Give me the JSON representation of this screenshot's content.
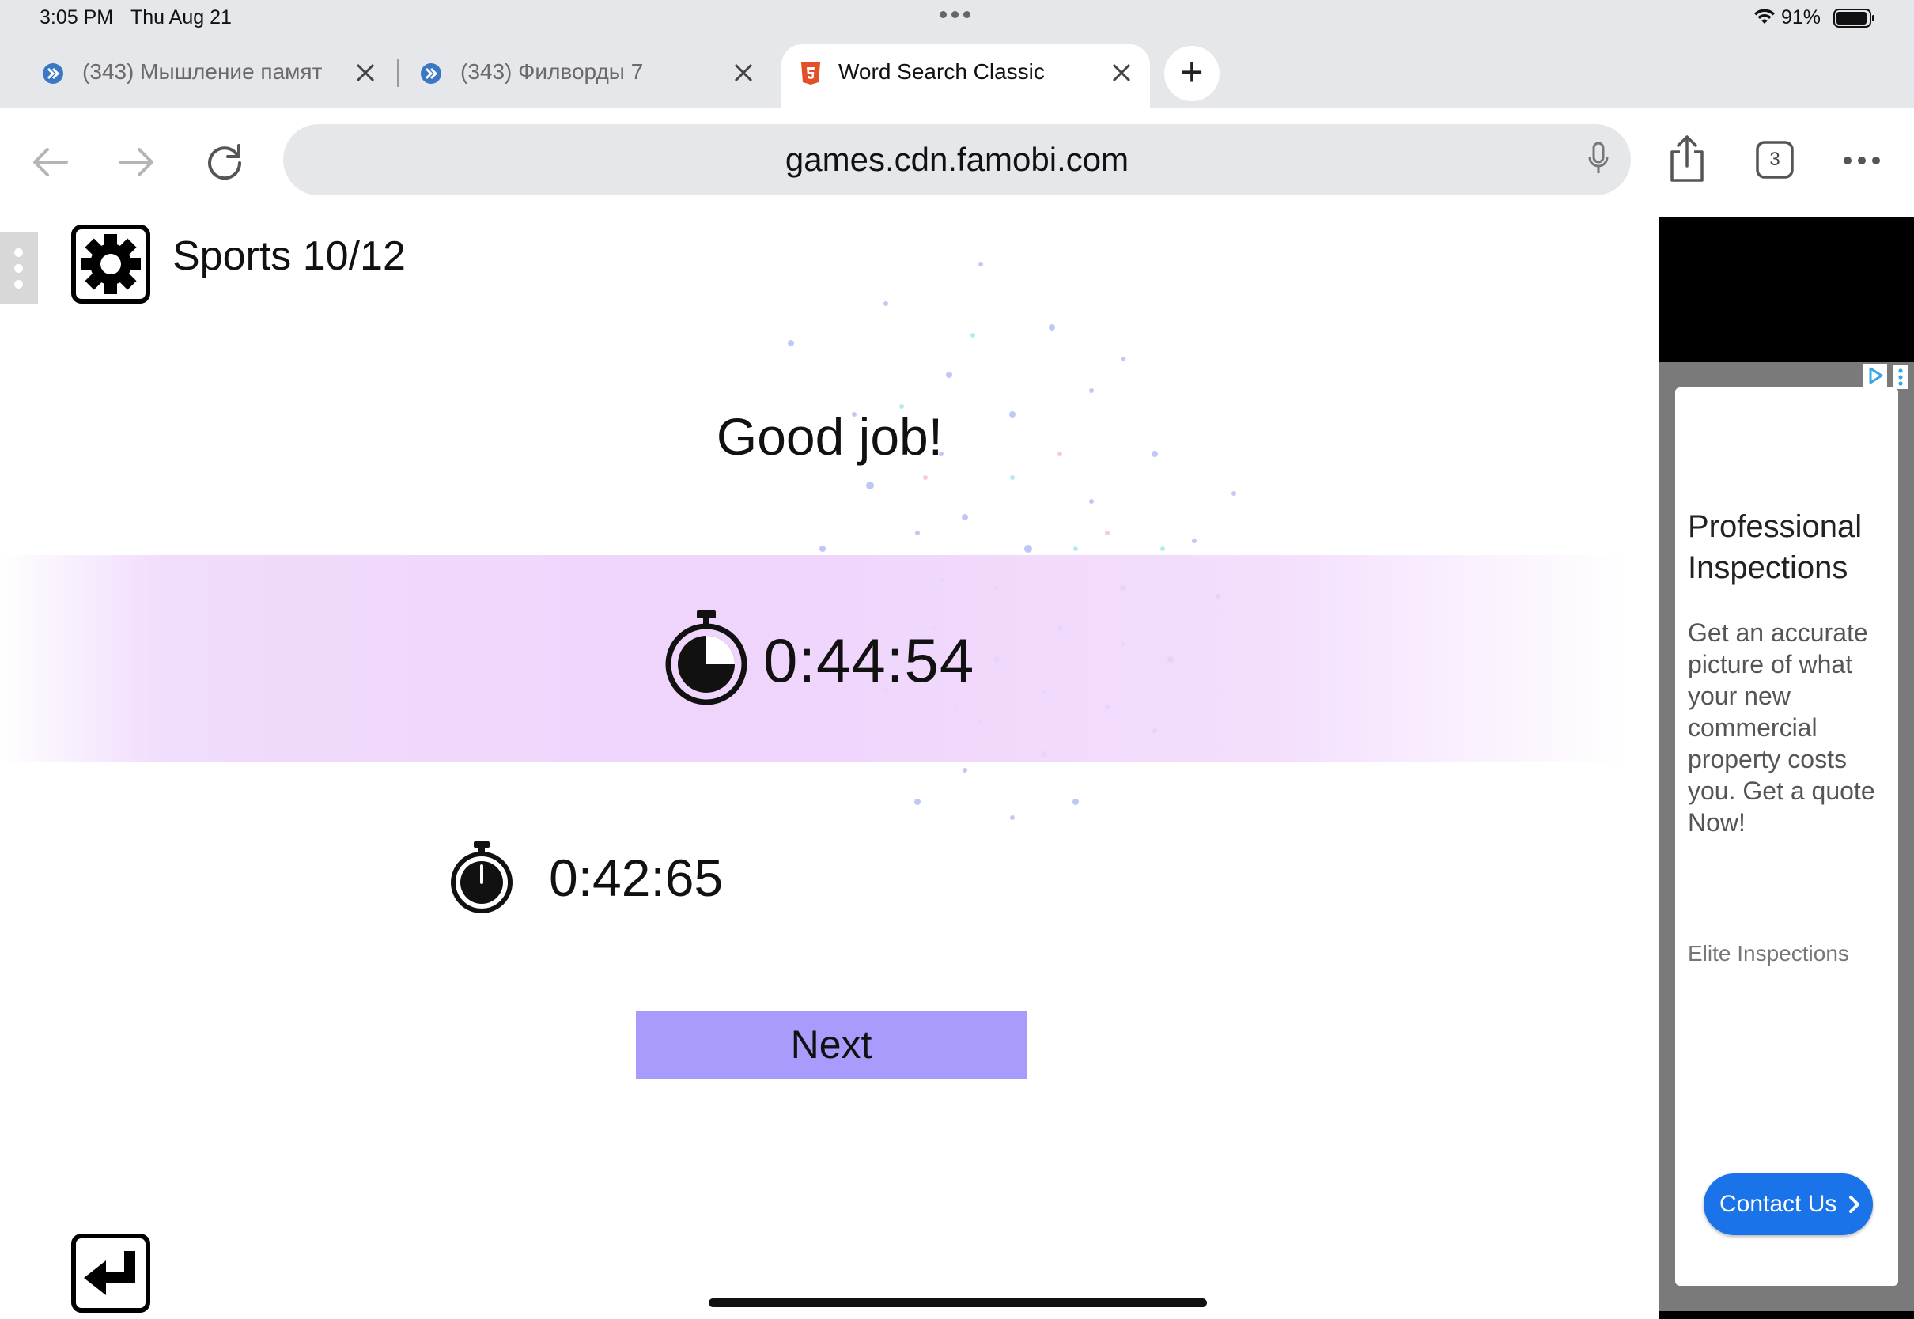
{
  "status_bar": {
    "time": "3:05 PM",
    "date": "Thu Aug 21",
    "battery_percent": "91%"
  },
  "tabs": [
    {
      "label": "(343) Мышление памят",
      "active": false
    },
    {
      "label": "(343) Филворды 7",
      "active": false
    },
    {
      "label": "Word Search Classic",
      "active": true
    }
  ],
  "toolbar": {
    "url": "games.cdn.famobi.com",
    "tab_count": "3"
  },
  "game": {
    "level_title": "Sports 10/12",
    "message": "Good job!",
    "current_time": "0:44:54",
    "best_time": "0:42:65",
    "next_label": "Next"
  },
  "ad": {
    "headline": "Professional Inspections",
    "body": "Get an accurate picture of what your new commercial property costs you. Get a quote Now!",
    "advertiser": "Elite Inspections",
    "cta_label": "Contact Us"
  },
  "colors": {
    "next_button": "#a79cfc",
    "time_band": "#efd4fc",
    "ad_cta": "#1a73e8"
  }
}
